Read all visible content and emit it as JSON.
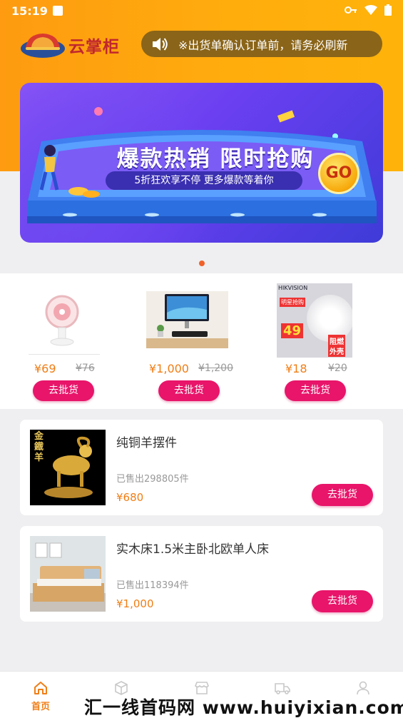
{
  "status_bar": {
    "time": "15:19"
  },
  "brand": {
    "name": "云掌柜"
  },
  "notice": {
    "text": "※出货单确认订单前，请务必刷新"
  },
  "banner": {
    "title": "爆款热销 限时抢购",
    "subtitle": "5折狂欢享不停 更多爆款等着你",
    "go": "GO"
  },
  "featured": [
    {
      "price": "¥69",
      "old_price": "¥76",
      "button": "去批货"
    },
    {
      "price": "¥1,000",
      "old_price": "¥1,200",
      "button": "去批货"
    },
    {
      "price": "¥18",
      "old_price": "¥20",
      "button": "去批货",
      "image_text": {
        "brand": "HIKVISION",
        "badge": "明星抢购",
        "price": "49",
        "tag1": "阻燃",
        "tag2": "外壳"
      }
    }
  ],
  "products": [
    {
      "title": "纯铜羊摆件",
      "sold": "已售出298805件",
      "price": "¥680",
      "button": "去批货",
      "image_text": "金鐡羊"
    },
    {
      "title": "实木床1.5米主卧北欧单人床",
      "sold": "已售出118394件",
      "price": "¥1,000",
      "button": "去批货"
    }
  ],
  "nav": {
    "items": [
      {
        "label": "首页"
      },
      {
        "label": ""
      },
      {
        "label": ""
      },
      {
        "label": ""
      },
      {
        "label": ""
      }
    ]
  },
  "watermark": "汇一线首码网 www.huiyixian.com",
  "colors": {
    "accent": "#f07e16",
    "button": "#e8156a",
    "header": "#fea20f"
  }
}
